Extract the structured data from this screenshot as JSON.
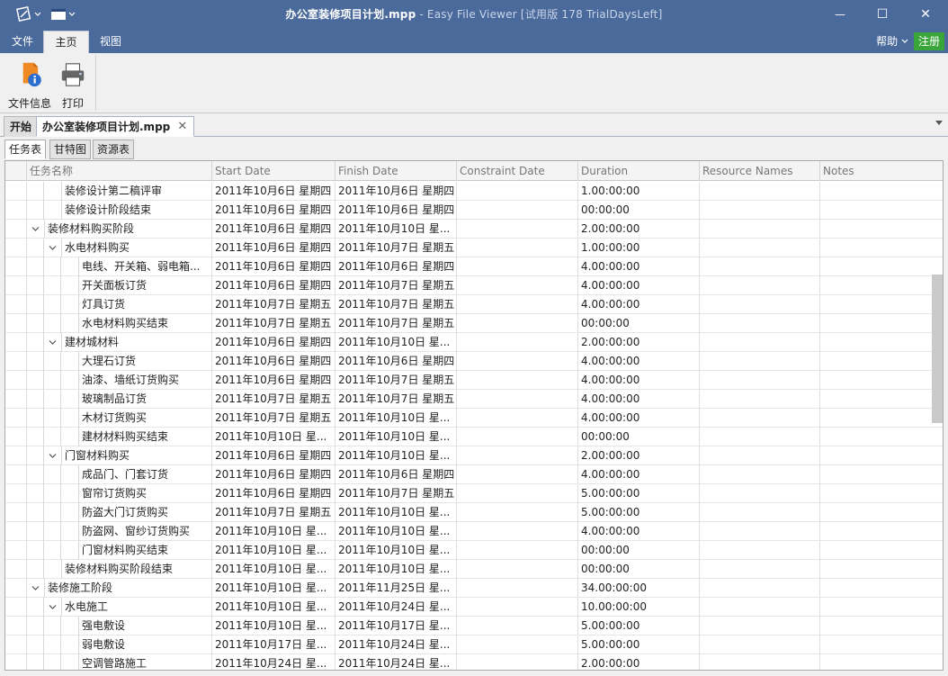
{
  "window": {
    "title_main": "办公室装修项目计划.mpp",
    "title_app": " - Easy File Viewer [试用版 178 TrialDaysLeft]",
    "minimize": "—",
    "maximize": "☐",
    "close": "✕"
  },
  "menu": {
    "file": "文件",
    "home": "主页",
    "view": "视图",
    "help": "帮助",
    "register": "注册"
  },
  "ribbon": {
    "file_info": "文件信息",
    "print": "打印"
  },
  "doc_tabs": {
    "start": "开始",
    "file": "办公室装修项目计划.mpp",
    "close": "✕"
  },
  "view_tabs": {
    "task": "任务表",
    "gantt": "甘特图",
    "resource": "资源表"
  },
  "columns": [
    "任务名称",
    "Start Date",
    "Finish Date",
    "Constraint Date",
    "Duration",
    "Resource Names",
    "Notes"
  ],
  "rows": [
    {
      "level": 2,
      "toggle": "",
      "name": "装修设计第二稿评审",
      "start": "2011年10月6日 星期四",
      "finish": "2011年10月6日 星期四",
      "constraint": "",
      "duration": "1.00:00:00",
      "resource": "",
      "notes": ""
    },
    {
      "level": 2,
      "toggle": "",
      "name": "装修设计阶段结束",
      "start": "2011年10月6日 星期四",
      "finish": "2011年10月6日 星期四",
      "constraint": "",
      "duration": "00:00:00",
      "resource": "",
      "notes": ""
    },
    {
      "level": 1,
      "toggle": "v",
      "name": "装修材料购买阶段",
      "start": "2011年10月6日 星期四",
      "finish": "2011年10月10日 星...",
      "constraint": "",
      "duration": "2.00:00:00",
      "resource": "",
      "notes": ""
    },
    {
      "level": 2,
      "toggle": "v",
      "name": "水电材料购买",
      "start": "2011年10月6日 星期四",
      "finish": "2011年10月7日 星期五",
      "constraint": "",
      "duration": "1.00:00:00",
      "resource": "",
      "notes": ""
    },
    {
      "level": 3,
      "toggle": "",
      "name": "电线、开关箱、弱电箱...",
      "start": "2011年10月6日 星期四",
      "finish": "2011年10月6日 星期四",
      "constraint": "",
      "duration": "4.00:00:00",
      "resource": "",
      "notes": ""
    },
    {
      "level": 3,
      "toggle": "",
      "name": "开关面板订货",
      "start": "2011年10月6日 星期四",
      "finish": "2011年10月7日 星期五",
      "constraint": "",
      "duration": "4.00:00:00",
      "resource": "",
      "notes": ""
    },
    {
      "level": 3,
      "toggle": "",
      "name": "灯具订货",
      "start": "2011年10月7日 星期五",
      "finish": "2011年10月7日 星期五",
      "constraint": "",
      "duration": "4.00:00:00",
      "resource": "",
      "notes": ""
    },
    {
      "level": 3,
      "toggle": "",
      "name": "水电材料购买结束",
      "start": "2011年10月7日 星期五",
      "finish": "2011年10月7日 星期五",
      "constraint": "",
      "duration": "00:00:00",
      "resource": "",
      "notes": ""
    },
    {
      "level": 2,
      "toggle": "v",
      "name": "建材城材料",
      "start": "2011年10月6日 星期四",
      "finish": "2011年10月10日 星...",
      "constraint": "",
      "duration": "2.00:00:00",
      "resource": "",
      "notes": ""
    },
    {
      "level": 3,
      "toggle": "",
      "name": "大理石订货",
      "start": "2011年10月6日 星期四",
      "finish": "2011年10月6日 星期四",
      "constraint": "",
      "duration": "4.00:00:00",
      "resource": "",
      "notes": ""
    },
    {
      "level": 3,
      "toggle": "",
      "name": "油漆、墙纸订货购买",
      "start": "2011年10月6日 星期四",
      "finish": "2011年10月7日 星期五",
      "constraint": "",
      "duration": "4.00:00:00",
      "resource": "",
      "notes": ""
    },
    {
      "level": 3,
      "toggle": "",
      "name": "玻璃制品订货",
      "start": "2011年10月7日 星期五",
      "finish": "2011年10月7日 星期五",
      "constraint": "",
      "duration": "4.00:00:00",
      "resource": "",
      "notes": ""
    },
    {
      "level": 3,
      "toggle": "",
      "name": "木材订货购买",
      "start": "2011年10月7日 星期五",
      "finish": "2011年10月10日 星...",
      "constraint": "",
      "duration": "4.00:00:00",
      "resource": "",
      "notes": ""
    },
    {
      "level": 3,
      "toggle": "",
      "name": "建材材料购买结束",
      "start": "2011年10月10日 星...",
      "finish": "2011年10月10日 星...",
      "constraint": "",
      "duration": "00:00:00",
      "resource": "",
      "notes": ""
    },
    {
      "level": 2,
      "toggle": "v",
      "name": "门窗材料购买",
      "start": "2011年10月6日 星期四",
      "finish": "2011年10月10日 星...",
      "constraint": "",
      "duration": "2.00:00:00",
      "resource": "",
      "notes": ""
    },
    {
      "level": 3,
      "toggle": "",
      "name": "成品门、门套订货",
      "start": "2011年10月6日 星期四",
      "finish": "2011年10月6日 星期四",
      "constraint": "",
      "duration": "4.00:00:00",
      "resource": "",
      "notes": ""
    },
    {
      "level": 3,
      "toggle": "",
      "name": "窗帘订货购买",
      "start": "2011年10月6日 星期四",
      "finish": "2011年10月7日 星期五",
      "constraint": "",
      "duration": "5.00:00:00",
      "resource": "",
      "notes": ""
    },
    {
      "level": 3,
      "toggle": "",
      "name": "防盗大门订货购买",
      "start": "2011年10月7日 星期五",
      "finish": "2011年10月10日 星...",
      "constraint": "",
      "duration": "5.00:00:00",
      "resource": "",
      "notes": ""
    },
    {
      "level": 3,
      "toggle": "",
      "name": "防盗网、窗纱订货购买",
      "start": "2011年10月10日 星...",
      "finish": "2011年10月10日 星...",
      "constraint": "",
      "duration": "4.00:00:00",
      "resource": "",
      "notes": ""
    },
    {
      "level": 3,
      "toggle": "",
      "name": "门窗材料购买结束",
      "start": "2011年10月10日 星...",
      "finish": "2011年10月10日 星...",
      "constraint": "",
      "duration": "00:00:00",
      "resource": "",
      "notes": ""
    },
    {
      "level": 2,
      "toggle": "",
      "name": "装修材料购买阶段结束",
      "start": "2011年10月10日 星...",
      "finish": "2011年10月10日 星...",
      "constraint": "",
      "duration": "00:00:00",
      "resource": "",
      "notes": ""
    },
    {
      "level": 1,
      "toggle": "v",
      "name": "装修施工阶段",
      "start": "2011年10月10日 星...",
      "finish": "2011年11月25日 星...",
      "constraint": "",
      "duration": "34.00:00:00",
      "resource": "",
      "notes": ""
    },
    {
      "level": 2,
      "toggle": "v",
      "name": "水电施工",
      "start": "2011年10月10日 星...",
      "finish": "2011年10月24日 星...",
      "constraint": "",
      "duration": "10.00:00:00",
      "resource": "",
      "notes": ""
    },
    {
      "level": 3,
      "toggle": "",
      "name": "强电敷设",
      "start": "2011年10月10日 星...",
      "finish": "2011年10月17日 星...",
      "constraint": "",
      "duration": "5.00:00:00",
      "resource": "",
      "notes": ""
    },
    {
      "level": 3,
      "toggle": "",
      "name": "弱电敷设",
      "start": "2011年10月17日 星...",
      "finish": "2011年10月24日 星...",
      "constraint": "",
      "duration": "5.00:00:00",
      "resource": "",
      "notes": ""
    },
    {
      "level": 3,
      "toggle": "",
      "name": "空调管路施工",
      "start": "2011年10月24日 星...",
      "finish": "2011年10月24日 星...",
      "constraint": "",
      "duration": "2.00:00:00",
      "resource": "",
      "notes": ""
    }
  ],
  "colors": {
    "titlebar": "#4a6a9c",
    "register": "#3aa53a",
    "fileinfo_orange": "#f08a24",
    "fileinfo_blue": "#2a6fd0"
  },
  "icons": {
    "app": "app-logo-icon",
    "quick": "window-layout-icon",
    "fileinfo": "file-info-icon",
    "print": "printer-icon"
  }
}
